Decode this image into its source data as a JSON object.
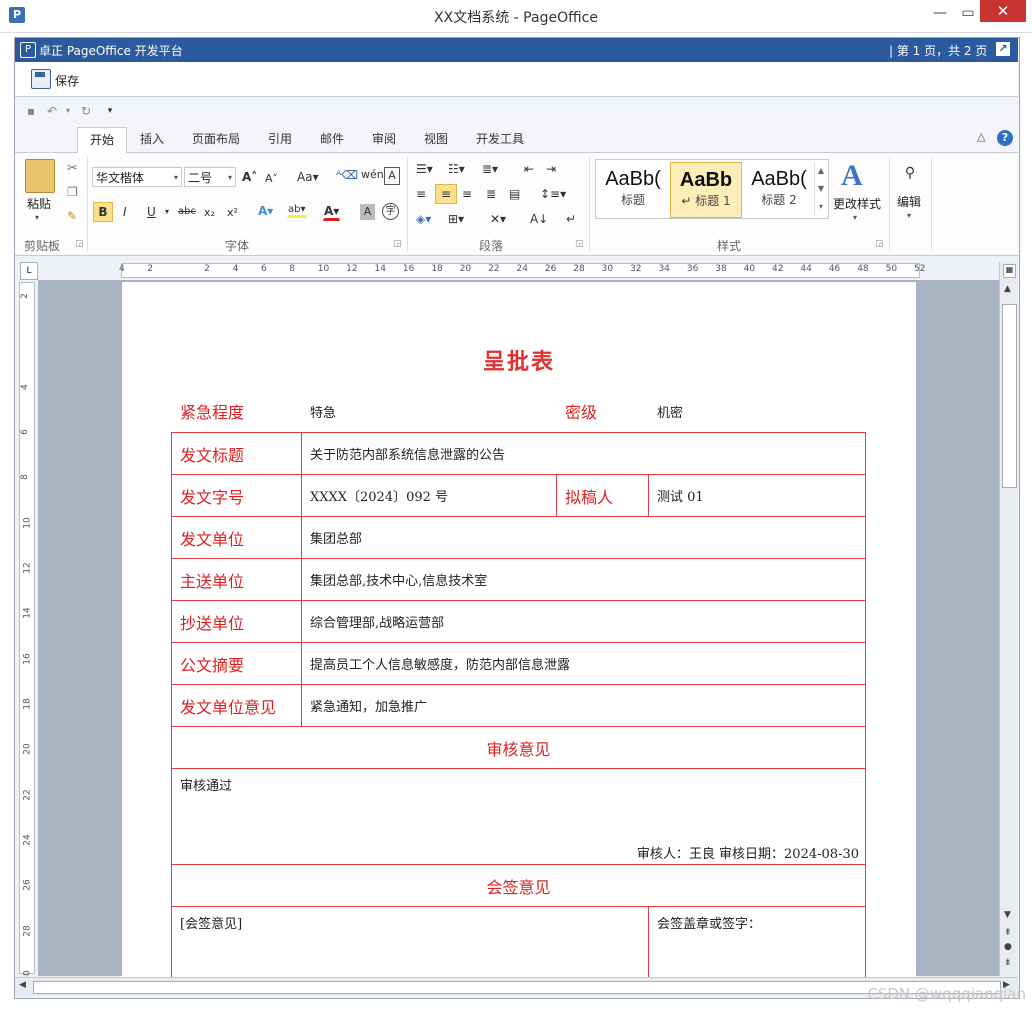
{
  "window": {
    "title": "XX文档系统 - PageOffice",
    "app_icon": "P"
  },
  "po_bar": {
    "title": "卓正 PageOffice 开发平台",
    "pages": "| 第 1 页，共 2 页",
    "save_label": "保存"
  },
  "ribbon": {
    "tabs": [
      "开始",
      "插入",
      "页面布局",
      "引用",
      "邮件",
      "审阅",
      "视图",
      "开发工具"
    ],
    "clipboard": {
      "label": "剪贴板",
      "paste": "粘贴"
    },
    "font": {
      "label": "字体",
      "font_name": "华文楷体",
      "font_size": "二号"
    },
    "paragraph": {
      "label": "段落"
    },
    "styles": {
      "label": "样式",
      "items": [
        {
          "sample": "AaBb(",
          "name": "标题"
        },
        {
          "sample": "AaBb",
          "name": "↵ 标题 1"
        },
        {
          "sample": "AaBb(",
          "name": "标题 2"
        }
      ],
      "change": "更改样式"
    },
    "editing": {
      "label": "编辑"
    }
  },
  "ruler": {
    "h_marks": [
      "4",
      "2",
      "",
      "2",
      "4",
      "6",
      "8",
      "10",
      "12",
      "14",
      "16",
      "18",
      "20",
      "22",
      "24",
      "26",
      "28",
      "30",
      "32",
      "34",
      "36",
      "38",
      "40",
      "42",
      "44",
      "46",
      "48",
      "50",
      "52"
    ],
    "v_marks": [
      "2",
      "",
      "4",
      "6",
      "8",
      "10",
      "12",
      "14",
      "16",
      "18",
      "20",
      "22",
      "24",
      "26",
      "28",
      "30"
    ]
  },
  "document": {
    "title": "呈批表",
    "urgency_label": "紧急程度",
    "urgency_value": "特急",
    "secret_label": "密级",
    "secret_value": "机密",
    "rows": {
      "subject_label": "发文标题",
      "subject_value": "关于防范内部系统信息泄露的公告",
      "docno_label": "发文字号",
      "docno_value": "XXXX〔2024〕092 号",
      "drafter_label": "拟稿人",
      "drafter_value": "测试 01",
      "unit_label": "发文单位",
      "unit_value": "集团总部",
      "main_label": "主送单位",
      "main_value": "集团总部,技术中心,信息技术室",
      "cc_label": "抄送单位",
      "cc_value": "综合管理部,战略运营部",
      "summary_label": "公文摘要",
      "summary_value": "提高员工个人信息敏感度，防范内部信息泄露",
      "opinion_label": "发文单位意见",
      "opinion_value": "紧急通知，加急推广"
    },
    "review": {
      "header": "审核意见",
      "text": "审核通过",
      "footer": "审核人：王良  审核日期：2024-08-30"
    },
    "countersign": {
      "header": "会签意见",
      "text": "[会签意见]",
      "stamp": "会签盖章或签字："
    }
  },
  "watermark": "CSDN @wqqqianqian"
}
